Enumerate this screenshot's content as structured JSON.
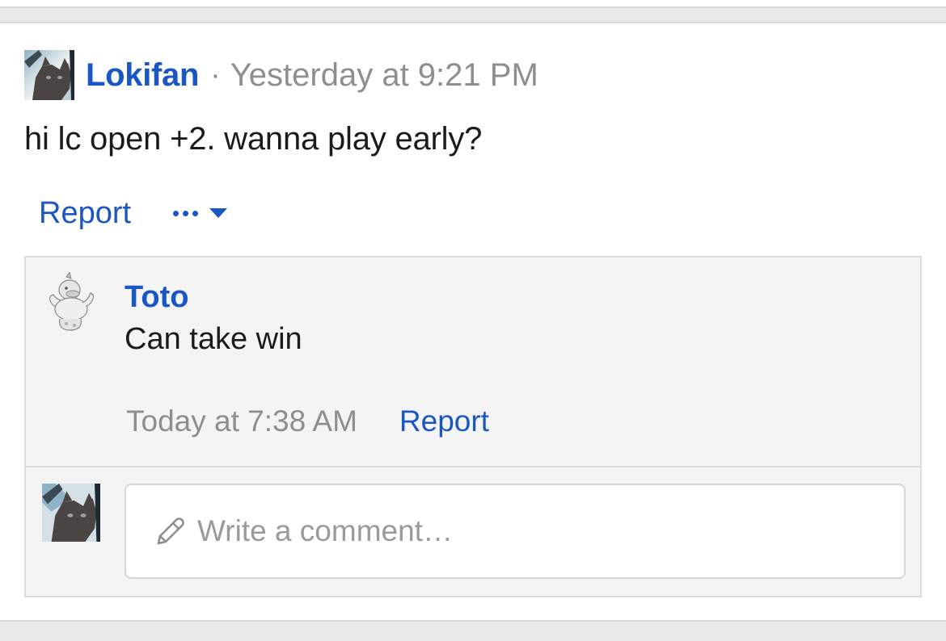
{
  "post": {
    "author": "Lokifan",
    "separator": "·",
    "timestamp": "Yesterday at 9:21 PM",
    "body": "hi lc open +2. wanna play early?",
    "report_label": "Report",
    "avatar_icon": "cat-avatar-icon",
    "more_icon": "more-options-icon"
  },
  "comments": [
    {
      "author": "Toto",
      "text": "Can take win",
      "timestamp": "Today at 7:38 AM",
      "report_label": "Report",
      "avatar_icon": "duck-avatar-icon"
    }
  ],
  "reply": {
    "placeholder": "Write a comment…",
    "icon": "pencil-icon",
    "avatar_icon": "cat-avatar-icon"
  },
  "colors": {
    "link": "#1a56c4",
    "muted": "#8e8e8e",
    "panel": "#f4f4f4",
    "border": "#dcdcdc"
  }
}
